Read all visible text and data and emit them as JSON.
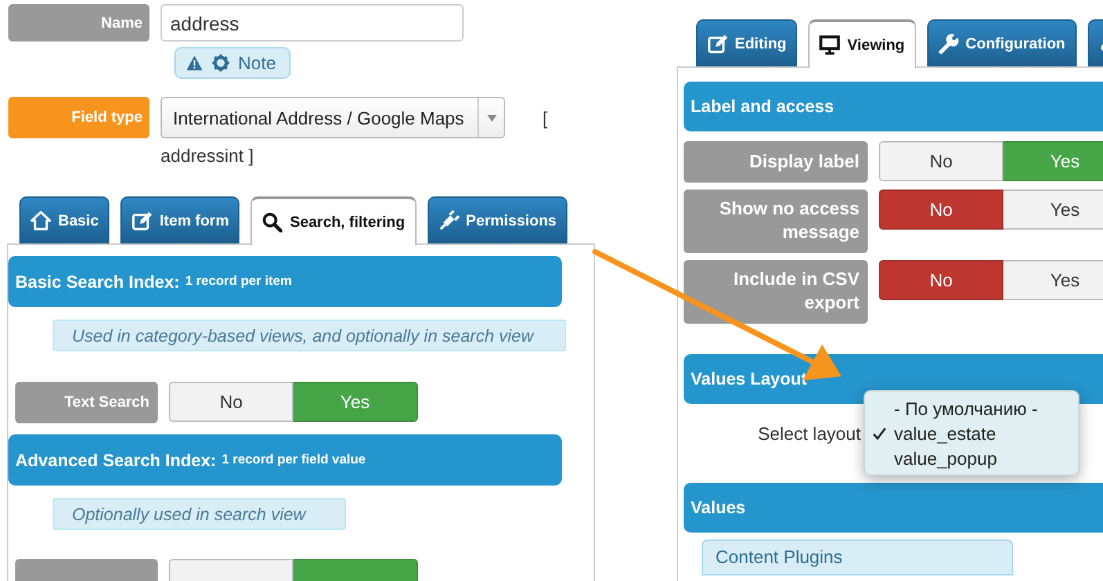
{
  "left": {
    "name_field": {
      "label": "Name",
      "required": false,
      "value": "address"
    },
    "note_button": {
      "label": "Note"
    },
    "field_type": {
      "label": "Field type",
      "required": true,
      "value": "International Address / Google Maps",
      "code_lines": [
        "[",
        "addressint ]"
      ]
    },
    "tabs": [
      {
        "label": "Basic",
        "selected": false
      },
      {
        "label": "Item form",
        "selected": false
      },
      {
        "label": "Search, filtering",
        "selected": true
      },
      {
        "label": "Permissions",
        "selected": false
      }
    ],
    "sections": [
      {
        "title": "Basic Search Index:",
        "subtitle": "1 record per item",
        "hint": "Used in category-based views, and optionally in search view",
        "rows": [
          {
            "kind": "toggle",
            "label": "Text Search",
            "options": [
              {
                "label": "No",
                "kind": "negative",
                "selected": false
              },
              {
                "label": "Yes",
                "kind": "positive",
                "selected": true
              }
            ]
          }
        ]
      },
      {
        "title": "Advanced Search Index:",
        "subtitle": "1 record per field value",
        "hint": "Optionally used in search view",
        "rows": [
          {
            "kind": "toggle",
            "options": [
              {
                "kind": "negative",
                "selected": false
              },
              {
                "kind": "positive",
                "selected": true
              }
            ]
          }
        ]
      }
    ]
  },
  "right": {
    "tabs": [
      {
        "label": "Editing",
        "selected": false
      },
      {
        "label": "Viewing",
        "selected": true
      },
      {
        "label": "Configuration",
        "selected": false
      },
      {
        "selected": false
      }
    ],
    "sections": [
      {
        "title": "Label and access",
        "rows": [
          {
            "kind": "toggle",
            "label": "Display label",
            "options": [
              {
                "label": "No",
                "kind": "negative",
                "selected": false
              },
              {
                "label": "Yes",
                "kind": "positive",
                "selected": true
              }
            ]
          },
          {
            "kind": "toggle",
            "label": "Show no access message",
            "options": [
              {
                "label": "No",
                "kind": "negative",
                "selected": true
              },
              {
                "label": "Yes",
                "kind": "positive",
                "selected": false
              }
            ]
          },
          {
            "kind": "toggle",
            "label": "Include in CSV export",
            "options": [
              {
                "label": "No",
                "kind": "negative",
                "selected": true
              },
              {
                "label": "Yes",
                "kind": "positive",
                "selected": false
              }
            ]
          }
        ]
      },
      {
        "title": "Values Layout",
        "rows": [
          {
            "kind": "select",
            "label": "Select layout"
          }
        ]
      },
      {
        "title": "Values",
        "rows": [
          {
            "kind": "note",
            "label": "Content Plugins"
          }
        ]
      }
    ],
    "dropdown": {
      "options": [
        {
          "label": "- По умолчанию -",
          "selected": false
        },
        {
          "label": "value_estate",
          "selected": true
        },
        {
          "label": "value_popup",
          "selected": false
        }
      ]
    }
  }
}
